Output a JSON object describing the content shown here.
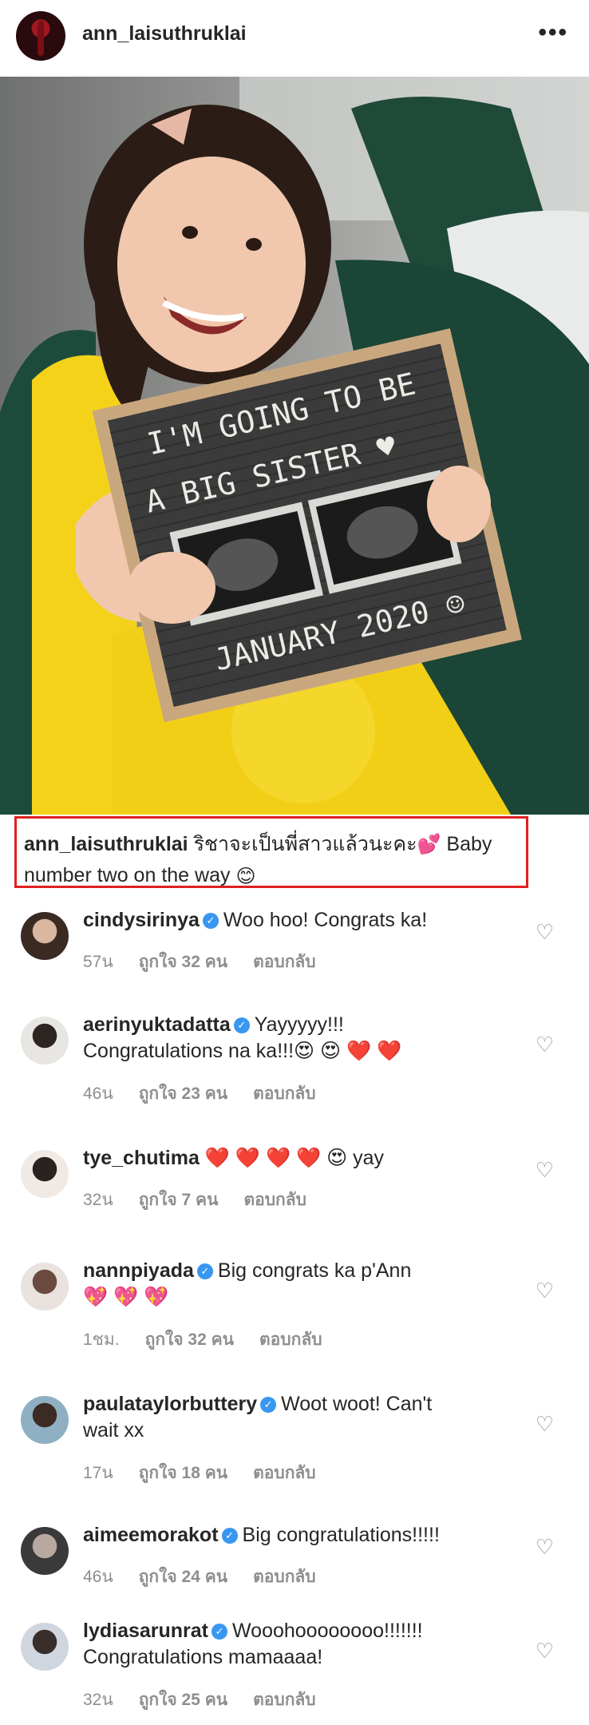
{
  "header": {
    "username": "ann_laisuthruklai",
    "more_icon": "more-horizontal-icon",
    "more_label": "•••"
  },
  "photo": {
    "board_line1": "I'M GOING TO BE",
    "board_line2": "A BIG SISTER ♥",
    "board_line3": "JANUARY 2020 ☺"
  },
  "caption": {
    "username": "ann_laisuthruklai",
    "text_thai": "ริชาจะเป็นพี่สาวแล้วนะคะ",
    "emoji": "💕",
    "text_line1_rest": "Baby",
    "text_line2": "number two on the way",
    "emoji2": "😊",
    "highlight_color": "#e02020"
  },
  "comments": [
    {
      "username": "cindysirinya",
      "verified": true,
      "text": "Woo hoo! Congrats ka!",
      "text2": "",
      "time": "57น",
      "likes": "ถูกใจ 32 คน",
      "reply": "ตอบกลับ"
    },
    {
      "username": "aerinyuktadatta",
      "verified": true,
      "text": "Yayyyyy!!!",
      "text2": "Congratulations na ka!!!😍 😍 ❤️ ❤️",
      "time": "46น",
      "likes": "ถูกใจ 23 คน",
      "reply": "ตอบกลับ"
    },
    {
      "username": "tye_chutima",
      "verified": false,
      "text": "❤️ ❤️ ❤️ ❤️ 😍  yay",
      "text2": "",
      "time": "32น",
      "likes": "ถูกใจ 7 คน",
      "reply": "ตอบกลับ"
    },
    {
      "username": "nannpiyada",
      "verified": true,
      "text": "Big congrats ka p'Ann",
      "text2": "💖 💖 💖",
      "time": "1ชม.",
      "likes": "ถูกใจ 32 คน",
      "reply": "ตอบกลับ"
    },
    {
      "username": "paulataylorbuttery",
      "verified": true,
      "text": "Woot woot! Can't",
      "text2": "wait xx",
      "time": "17น",
      "likes": "ถูกใจ 18 คน",
      "reply": "ตอบกลับ"
    },
    {
      "username": "aimeemorakot",
      "verified": true,
      "text": "Big congratulations!!!!!",
      "text2": "",
      "time": "46น",
      "likes": "ถูกใจ 24 คน",
      "reply": "ตอบกลับ"
    },
    {
      "username": "lydiasarunrat",
      "verified": true,
      "text": "Wooohoooooooo!!!!!!!",
      "text2": "Congratulations mamaaaa!",
      "time": "32น",
      "likes": "ถูกใจ 25 คน",
      "reply": "ตอบกลับ"
    }
  ],
  "icons": {
    "heart": "heart-outline-icon",
    "verified": "verified-badge-icon"
  },
  "heart_glyph": "♡",
  "verified_glyph": "✓"
}
